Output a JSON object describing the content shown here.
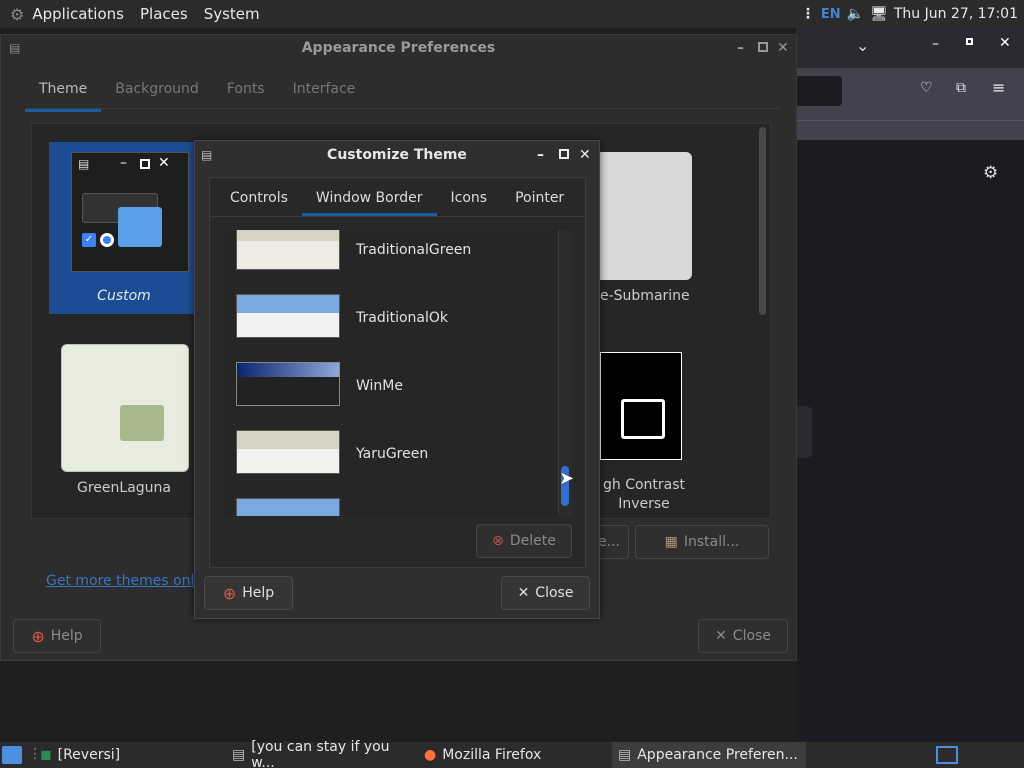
{
  "top_panel": {
    "menus": [
      "Applications",
      "Places",
      "System"
    ],
    "keyboard_layout": "EN",
    "clock": "Thu Jun 27, 17:01"
  },
  "appearance_window": {
    "title": "Appearance Preferences",
    "tabs": [
      "Theme",
      "Background",
      "Fonts",
      "Interface"
    ],
    "active_tab": "Theme",
    "themes": [
      {
        "name": "Custom",
        "selected": true
      },
      {
        "name": "e-Submarine"
      },
      {
        "name": "GreenLaguna"
      },
      {
        "name": "gh Contrast\nInverse"
      }
    ],
    "get_more_link": "Get more themes onli",
    "buttons": {
      "save_partial": "e...",
      "install": "Install...",
      "help": "Help",
      "close": "Close"
    }
  },
  "customize_dialog": {
    "title": "Customize Theme",
    "tabs": [
      "Controls",
      "Window Border",
      "Icons",
      "Pointer"
    ],
    "active_tab": "Window Border",
    "items": [
      "TraditionalGreen",
      "TraditionalOk",
      "WinMe",
      "YaruGreen"
    ],
    "buttons": {
      "delete": "Delete",
      "help": "Help",
      "close": "Close"
    }
  },
  "taskbar": {
    "tasks": [
      "[Reversi]",
      "[you can stay if you w...",
      "Mozilla Firefox",
      "Appearance Preferen..."
    ]
  }
}
